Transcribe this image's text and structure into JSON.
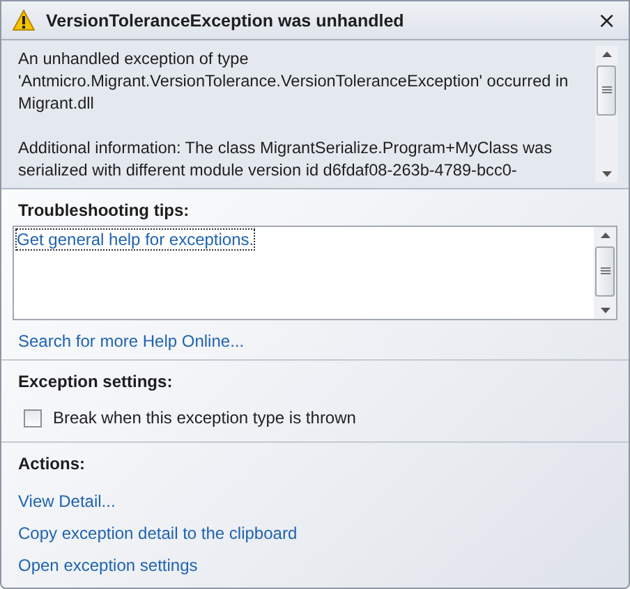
{
  "window": {
    "title": "VersionToleranceException was unhandled",
    "close": "×"
  },
  "message": {
    "paragraphs": [
      "An unhandled exception of type 'Antmicro.Migrant.VersionTolerance.VersionToleranceException' occurred in Migrant.dll",
      "Additional information: The class MigrantSerialize.Program+MyClass was serialized with different module version id d6fdaf08-263b-4789-bcc0-"
    ]
  },
  "troubleshooting": {
    "heading": "Troubleshooting tips:",
    "tips": [
      "Get general help for exceptions."
    ],
    "link": "Search for more Help Online..."
  },
  "exception_settings": {
    "heading": "Exception settings:",
    "options": [
      {
        "label": "Break when this exception type is thrown",
        "checked": false
      }
    ]
  },
  "actions": {
    "heading": "Actions:",
    "links": [
      "View Detail...",
      "Copy exception detail to the clipboard",
      "Open exception settings"
    ]
  }
}
